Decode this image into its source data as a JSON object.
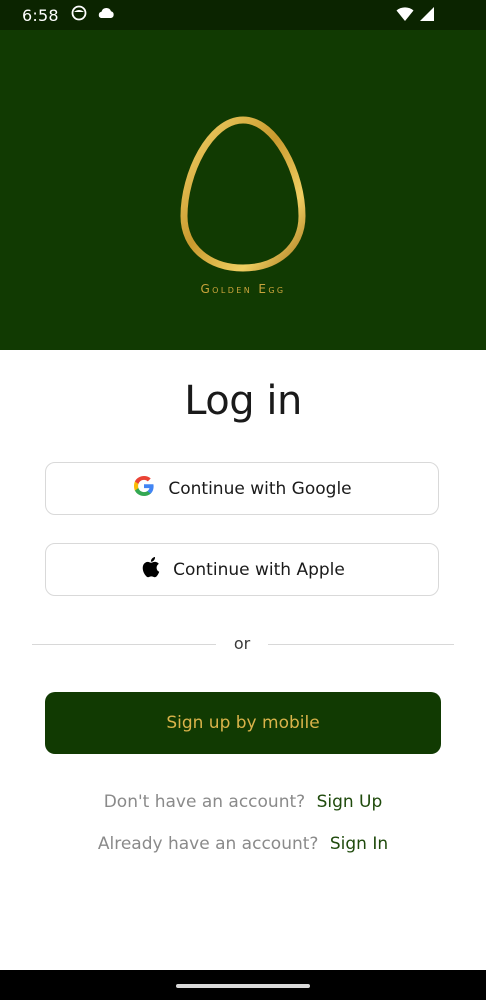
{
  "status_bar": {
    "time": "6:58",
    "icons": [
      "face-icon",
      "cloud-icon",
      "wifi-icon",
      "signal-icon"
    ]
  },
  "brand": {
    "name": "Golden Egg",
    "logo_icon": "golden-egg-logo"
  },
  "login": {
    "title": "Log in",
    "google_label": "Continue with Google",
    "apple_label": "Continue with Apple",
    "divider_text": "or",
    "primary_label": "Sign up by mobile",
    "signup_prompt": "Don't have an account?",
    "signup_link": "Sign Up",
    "signin_prompt": "Already have an account?",
    "signin_link": "Sign In"
  },
  "colors": {
    "hero_bg": "#113a02",
    "status_bg": "#0b2400",
    "gold": "#c9a43b",
    "primary_text": "#d9b34a",
    "link": "#1f4a0c"
  }
}
